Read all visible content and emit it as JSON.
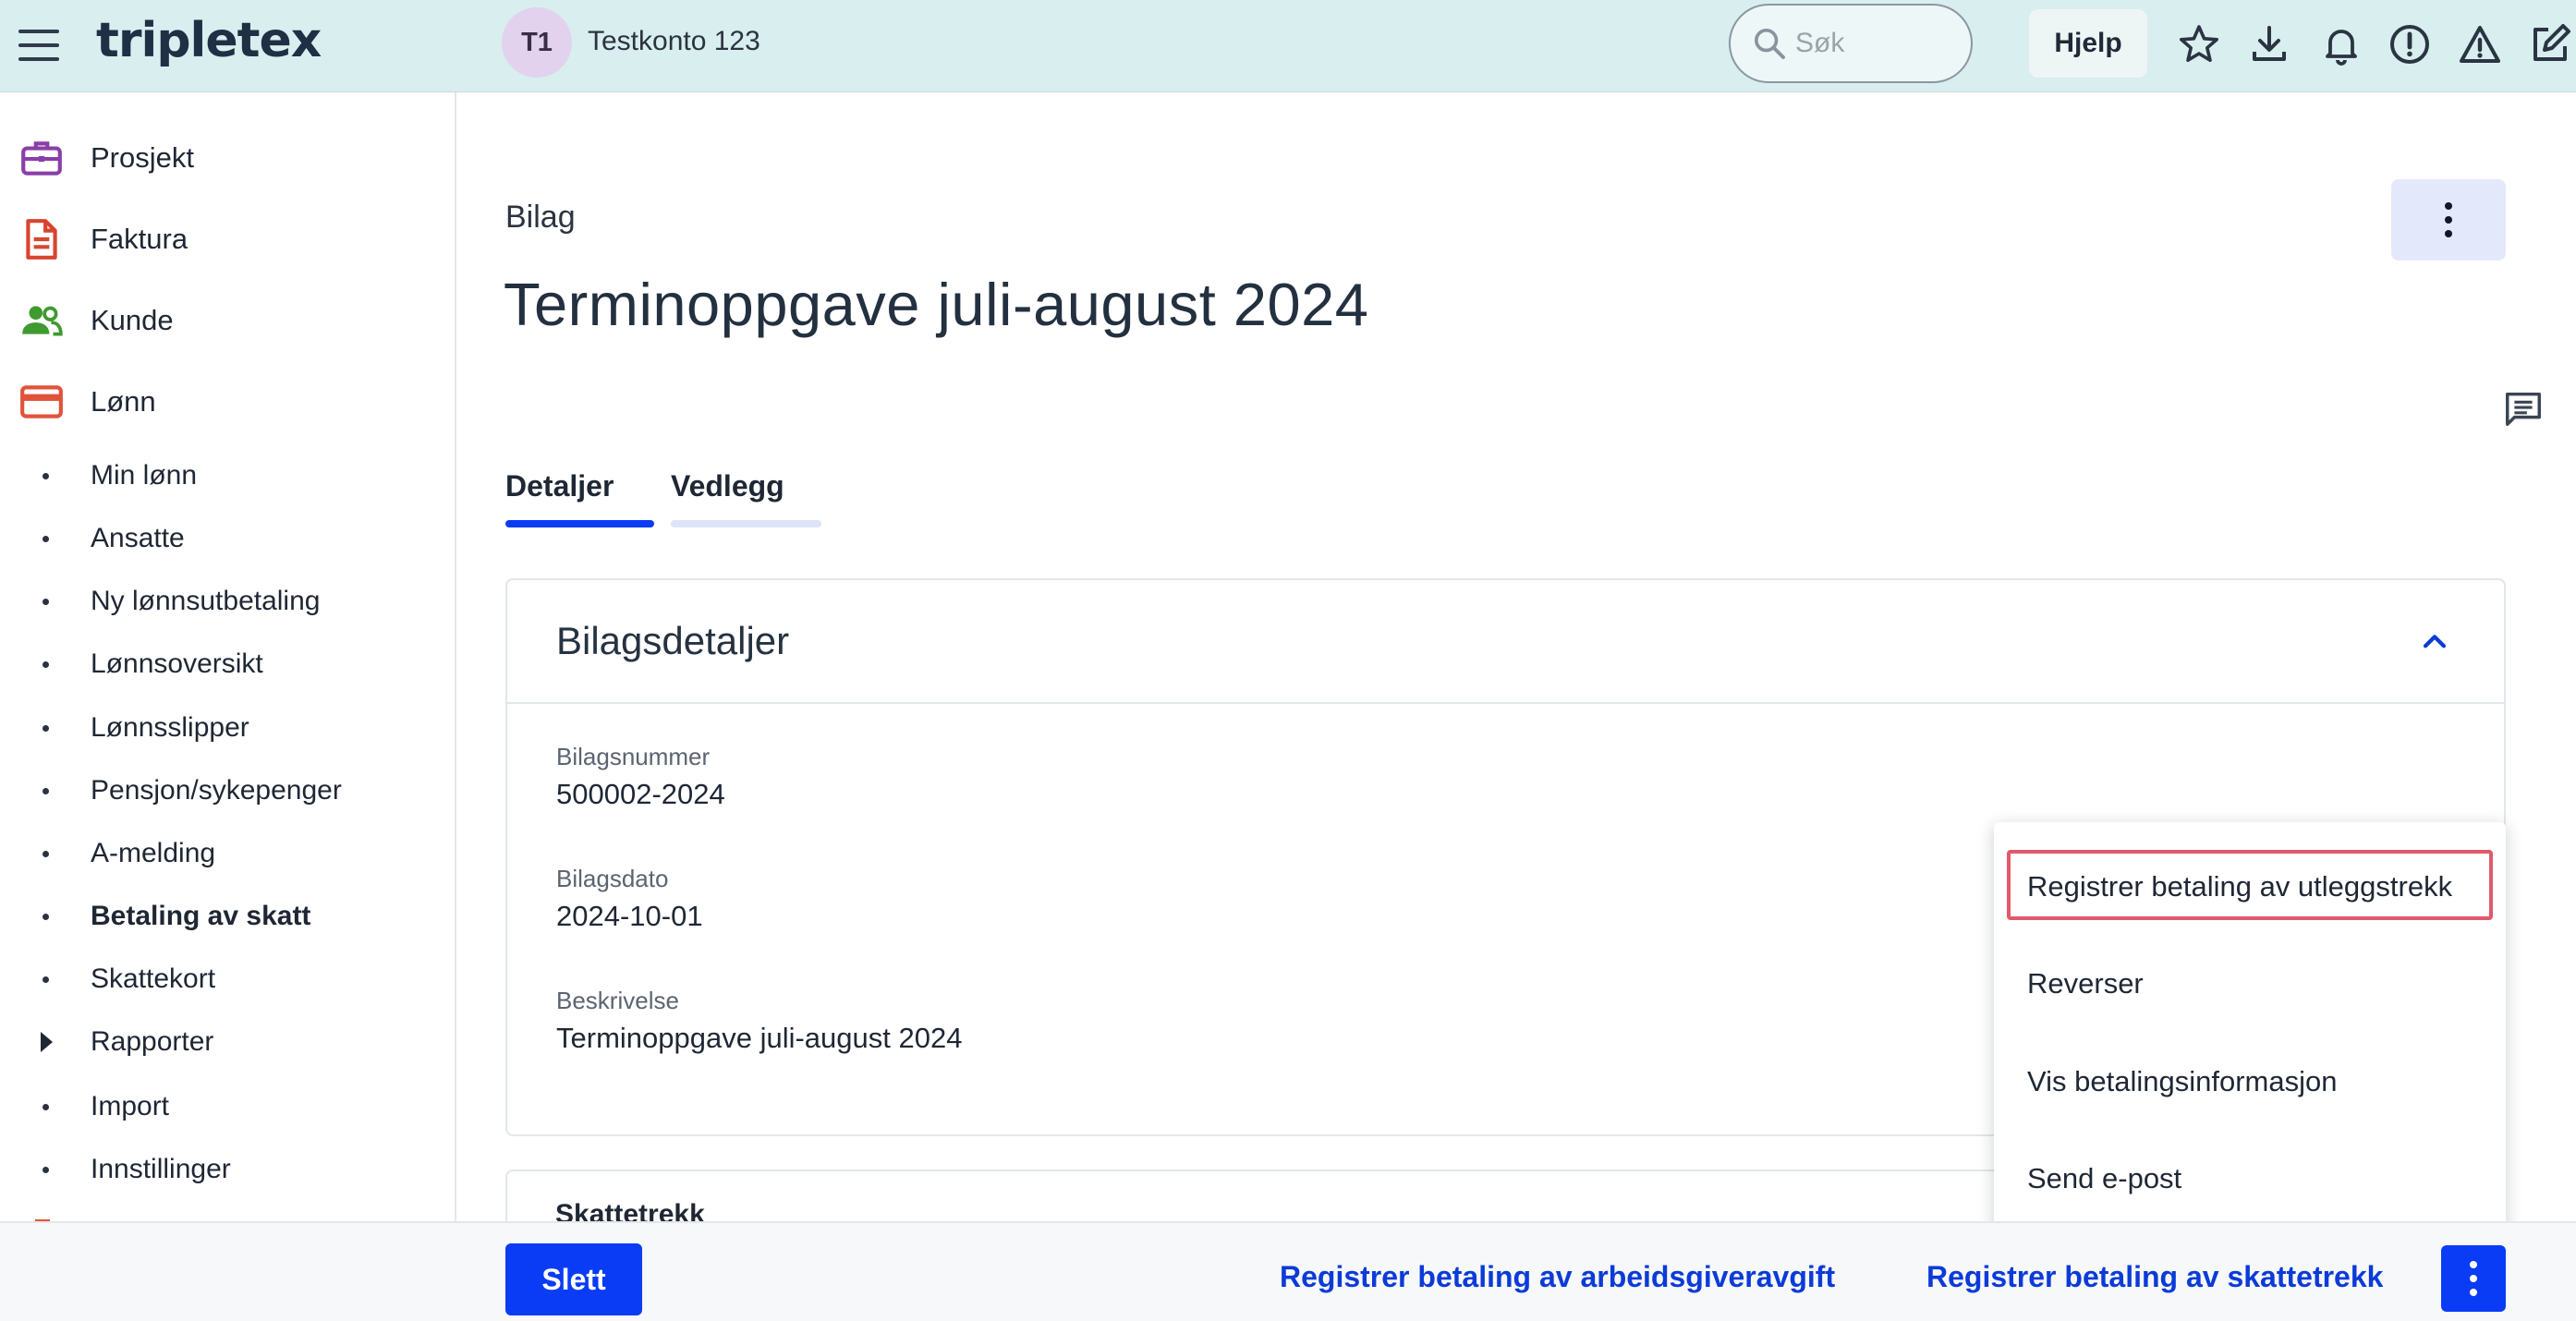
{
  "topbar": {
    "logo": "tripletex",
    "avatar_initials": "T1",
    "account_name": "Testkonto 123",
    "search_placeholder": "Søk",
    "help_label": "Hjelp",
    "icons": [
      "star-icon",
      "download-icon",
      "bell-icon",
      "alert-circle-icon",
      "warning-icon",
      "edit-external-icon"
    ]
  },
  "sidebar": {
    "main_items": [
      {
        "label": "Prosjekt",
        "icon": "briefcase-icon",
        "color": "#8a3fa8"
      },
      {
        "label": "Faktura",
        "icon": "document-icon",
        "color": "#d9442f"
      },
      {
        "label": "Kunde",
        "icon": "people-icon",
        "color": "#3f9a2f"
      },
      {
        "label": "Lønn",
        "icon": "card-icon",
        "color": "#e0533b"
      }
    ],
    "sub_items": [
      {
        "label": "Min lønn"
      },
      {
        "label": "Ansatte"
      },
      {
        "label": "Ny lønnsutbetaling"
      },
      {
        "label": "Lønnsoversikt"
      },
      {
        "label": "Lønnsslipper"
      },
      {
        "label": "Pensjon/sykepenger"
      },
      {
        "label": "A-melding"
      },
      {
        "label": "Betaling av skatt",
        "active": true
      },
      {
        "label": "Skattekort"
      },
      {
        "label": "Rapporter",
        "expandable": true
      },
      {
        "label": "Import"
      },
      {
        "label": "Innstillinger"
      }
    ]
  },
  "main": {
    "breadcrumb": "Bilag",
    "title": "Terminoppgave juli-august 2024",
    "tabs": [
      {
        "label": "Detaljer",
        "active": true
      },
      {
        "label": "Vedlegg",
        "active": false
      }
    ],
    "details_card": {
      "title": "Bilagsdetaljer",
      "fields": [
        {
          "label": "Bilagsnummer",
          "value": "500002-2024"
        },
        {
          "label": "Bilagsdato",
          "value": "2024-10-01"
        },
        {
          "label": "Beskrivelse",
          "value": "Terminoppgave juli-august 2024"
        }
      ]
    },
    "second_card": {
      "title": "Skattetrekk"
    }
  },
  "menu": {
    "items": [
      {
        "label": "Registrer betaling av utleggstrekk",
        "highlighted": true
      },
      {
        "label": "Reverser"
      },
      {
        "label": "Vis betalingsinformasjon"
      },
      {
        "label": "Send e-post"
      }
    ]
  },
  "bottombar": {
    "delete_label": "Slett",
    "link1": "Registrer betaling av arbeidsgiveravgift",
    "link2": "Registrer betaling av skattetrekk"
  },
  "colors": {
    "topbar_bg": "#d9eeee",
    "primary": "#0a3cf5",
    "link": "#0b3bd8",
    "highlight_border": "#e05a6a"
  }
}
